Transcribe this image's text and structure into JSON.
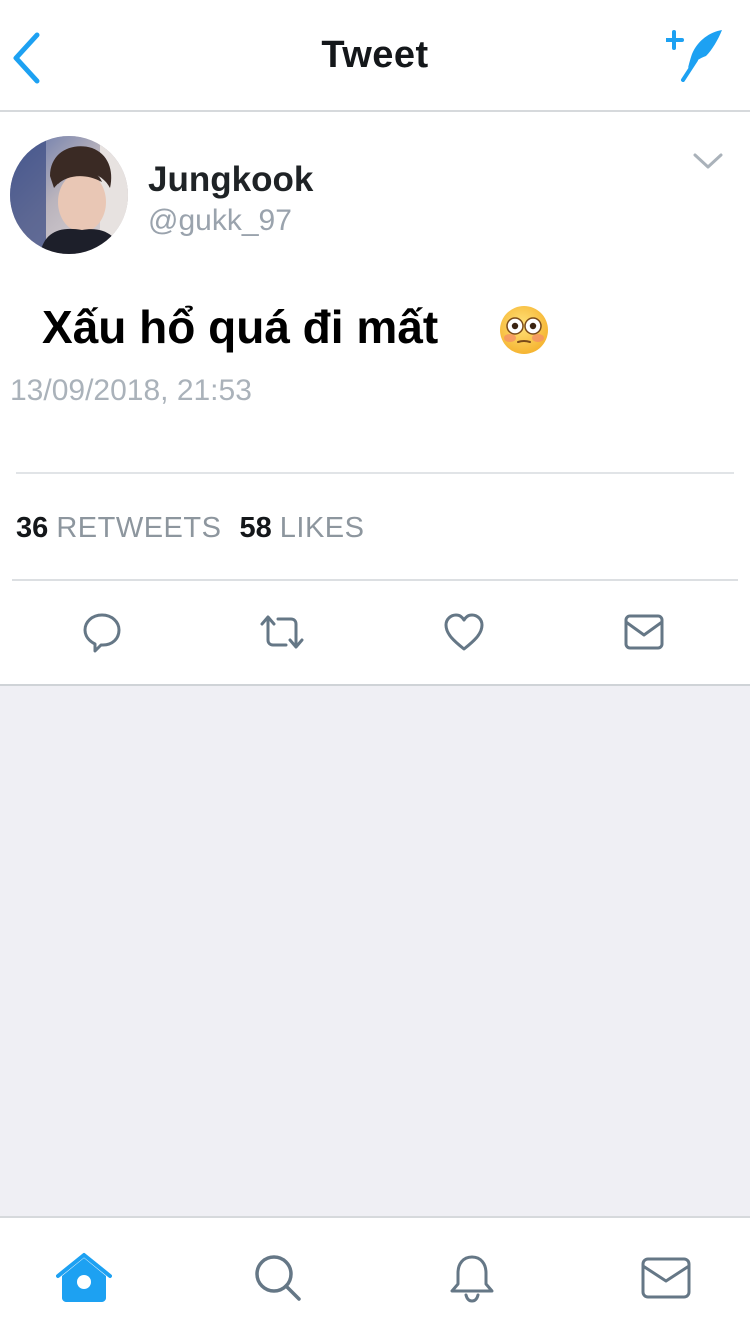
{
  "header": {
    "title": "Tweet",
    "back_icon": "chevron-left-icon",
    "compose_icon": "compose-feather-icon"
  },
  "tweet": {
    "author": {
      "display_name": "Jungkook",
      "username": "@gukk_97"
    },
    "text": "Xấu hổ quá đi mất",
    "emoji": "flushed-face-emoji",
    "timestamp": "13/09/2018, 21:53",
    "stats": {
      "retweets_count": "36",
      "retweets_label": "RETWEETS",
      "likes_count": "58",
      "likes_label": "LIKES"
    },
    "actions": [
      "reply-icon",
      "retweet-icon",
      "like-icon",
      "direct-message-icon"
    ]
  },
  "tabbar": {
    "tabs": [
      "home-icon",
      "search-icon",
      "notifications-icon",
      "messages-icon"
    ],
    "active_tab": "home-icon"
  },
  "colors": {
    "accent": "#1da1f2",
    "icon_gray": "#657786",
    "background_gray": "#efeff4"
  }
}
